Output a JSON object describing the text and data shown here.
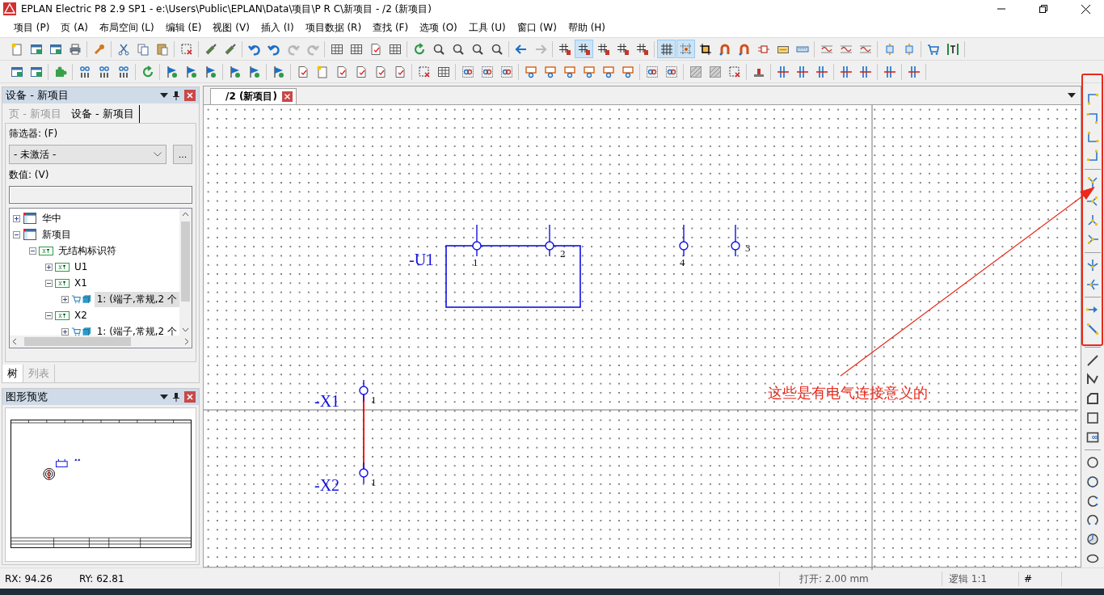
{
  "window": {
    "title": "EPLAN Electric P8 2.9 SP1 - e:\\Users\\Public\\EPLAN\\Data\\项目\\P R C\\新项目 - /2 (新项目)"
  },
  "menu": [
    "项目 (P)",
    "页 (A)",
    "布局空间 (L)",
    "编辑 (E)",
    "视图 (V)",
    "插入 (I)",
    "项目数据 (R)",
    "查找 (F)",
    "选项 (O)",
    "工具 (U)",
    "窗口 (W)",
    "帮助 (H)"
  ],
  "toolbars": [
    [
      [
        {
          "kind": "page",
          "pressed": false
        },
        {
          "kind": "window",
          "pressed": false
        },
        {
          "kind": "window",
          "pressed": false
        },
        {
          "kind": "printer",
          "pressed": false
        }
      ],
      [
        {
          "kind": "wrench",
          "pressed": false
        }
      ],
      [
        {
          "kind": "scissors",
          "pressed": false
        },
        {
          "kind": "copy",
          "pressed": false
        },
        {
          "kind": "paste",
          "pressed": false
        }
      ],
      [
        {
          "kind": "select",
          "pressed": false
        }
      ],
      [
        {
          "kind": "brush",
          "pressed": false
        },
        {
          "kind": "brush",
          "pressed": false
        }
      ],
      [
        {
          "kind": "undo",
          "pressed": false
        },
        {
          "kind": "undo",
          "pressed": false
        },
        {
          "kind": "redo",
          "pressed": false
        },
        {
          "kind": "redo",
          "pressed": false
        }
      ],
      [
        {
          "kind": "table",
          "pressed": false
        },
        {
          "kind": "table",
          "pressed": false
        },
        {
          "kind": "doc",
          "pressed": false
        },
        {
          "kind": "table",
          "pressed": false
        }
      ],
      [
        {
          "kind": "refresh",
          "pressed": false
        },
        {
          "kind": "zoom",
          "pressed": false
        },
        {
          "kind": "zoom",
          "pressed": false
        },
        {
          "kind": "zoom",
          "pressed": false
        },
        {
          "kind": "zoom",
          "pressed": false
        }
      ],
      [
        {
          "kind": "arrow-left",
          "pressed": false
        },
        {
          "kind": "arrow-right",
          "pressed": false
        }
      ],
      [
        {
          "kind": "hash",
          "pressed": false
        },
        {
          "kind": "hash",
          "pressed": true
        },
        {
          "kind": "hash",
          "pressed": false
        },
        {
          "kind": "hash",
          "pressed": false
        },
        {
          "kind": "hash",
          "pressed": false
        }
      ],
      [
        {
          "kind": "grid",
          "pressed": true
        },
        {
          "kind": "snap",
          "pressed": true
        },
        {
          "kind": "crop",
          "pressed": false
        },
        {
          "kind": "magnet",
          "pressed": false
        },
        {
          "kind": "magnet",
          "pressed": false
        },
        {
          "kind": "symbol",
          "pressed": false
        },
        {
          "kind": "counter",
          "pressed": false
        },
        {
          "kind": "ruler",
          "pressed": false
        }
      ],
      [
        {
          "kind": "wave",
          "pressed": false
        },
        {
          "kind": "wave",
          "pressed": false
        },
        {
          "kind": "wave",
          "pressed": false
        }
      ],
      [
        {
          "kind": "chip",
          "pressed": false
        },
        {
          "kind": "chip",
          "pressed": false
        }
      ],
      [
        {
          "kind": "cart",
          "pressed": false
        },
        {
          "kind": "frame",
          "pressed": false
        }
      ]
    ],
    [
      [
        {
          "kind": "window",
          "pressed": false
        },
        {
          "kind": "window",
          "pressed": false
        }
      ],
      [
        {
          "kind": "puzzle",
          "pressed": false
        }
      ],
      [
        {
          "kind": "numbers",
          "pressed": false
        },
        {
          "kind": "numbers",
          "pressed": false
        },
        {
          "kind": "numbers",
          "pressed": false
        }
      ],
      [
        {
          "kind": "refresh",
          "pressed": false
        }
      ],
      [
        {
          "kind": "flag",
          "pressed": false
        },
        {
          "kind": "flag",
          "pressed": false
        },
        {
          "kind": "flag",
          "pressed": false
        }
      ],
      [
        {
          "kind": "flag",
          "pressed": false
        },
        {
          "kind": "flag",
          "pressed": false
        }
      ],
      [
        {
          "kind": "flag",
          "pressed": false
        }
      ],
      [
        {
          "kind": "doc",
          "pressed": false
        },
        {
          "kind": "page",
          "pressed": false
        },
        {
          "kind": "doc",
          "pressed": false
        },
        {
          "kind": "doc",
          "pressed": false
        },
        {
          "kind": "doc",
          "pressed": false
        },
        {
          "kind": "doc",
          "pressed": false
        }
      ],
      [
        {
          "kind": "select",
          "pressed": false
        },
        {
          "kind": "table",
          "pressed": false
        }
      ],
      [
        {
          "kind": "rings",
          "pressed": false
        },
        {
          "kind": "rings",
          "pressed": false
        },
        {
          "kind": "rings",
          "pressed": false
        }
      ],
      [
        {
          "kind": "connector",
          "pressed": false
        },
        {
          "kind": "connector",
          "pressed": false
        },
        {
          "kind": "connector",
          "pressed": false
        },
        {
          "kind": "connector",
          "pressed": false
        },
        {
          "kind": "connector",
          "pressed": false
        },
        {
          "kind": "connector",
          "pressed": false
        }
      ],
      [
        {
          "kind": "rings",
          "pressed": false
        },
        {
          "kind": "rings",
          "pressed": false
        }
      ],
      [
        {
          "kind": "hatch",
          "pressed": false
        },
        {
          "kind": "hatch",
          "pressed": false
        },
        {
          "kind": "select",
          "pressed": false
        }
      ],
      [
        {
          "kind": "stamp",
          "pressed": false
        }
      ],
      [
        {
          "kind": "lines",
          "pressed": false
        },
        {
          "kind": "lines",
          "pressed": false
        },
        {
          "kind": "lines",
          "pressed": false
        }
      ],
      [
        {
          "kind": "lines",
          "pressed": false
        },
        {
          "kind": "lines",
          "pressed": false
        }
      ],
      [
        {
          "kind": "lines",
          "pressed": false
        }
      ],
      [
        {
          "kind": "lines",
          "pressed": false
        }
      ]
    ]
  ],
  "device_panel": {
    "title": "设备 - 新项目",
    "tabs": [
      {
        "label": "页 - 新项目",
        "selected": false
      },
      {
        "label": "设备 - 新项目",
        "selected": true
      }
    ],
    "filter_label": "筛选器: (F)",
    "filter_value": "- 未激活 -",
    "filter_button": "...",
    "value_label": "数值: (V)",
    "tree": [
      {
        "kind": "project",
        "label": "华中",
        "expanded": false,
        "selected": false
      },
      {
        "kind": "project",
        "label": "新项目",
        "expanded": true,
        "selected": false,
        "children": [
          {
            "kind": "structure",
            "label": "无结构标识符",
            "expanded": true,
            "selected": false,
            "children": [
              {
                "kind": "structure",
                "label": "U1",
                "expanded": false,
                "selected": false
              },
              {
                "kind": "structure",
                "label": "X1",
                "expanded": true,
                "selected": false,
                "children": [
                  {
                    "kind": "part",
                    "label": "1: (端子,常规,2 个",
                    "expanded": false,
                    "selected": true
                  }
                ]
              },
              {
                "kind": "structure",
                "label": "X2",
                "expanded": true,
                "selected": false,
                "children": [
                  {
                    "kind": "part",
                    "label": "1: (端子,常规,2 个",
                    "expanded": false,
                    "selected": false
                  }
                ]
              }
            ]
          }
        ]
      }
    ],
    "bottom_tabs": [
      {
        "label": "树",
        "selected": true
      },
      {
        "label": "列表",
        "selected": false
      }
    ]
  },
  "preview_panel": {
    "title": "图形预览"
  },
  "document_tab": {
    "label": "/2 (新项目)"
  },
  "schematic": {
    "u1": {
      "name": "-U1",
      "pins": [
        "1",
        "2"
      ]
    },
    "loose_pins": [
      "4",
      "3"
    ],
    "x1": {
      "name": "-X1",
      "pin": "1"
    },
    "x2": {
      "name": "-X2",
      "pin": "1"
    }
  },
  "annotation": "这些是有电气连接意义的",
  "status_bar": {
    "rx": "RX: 94.26",
    "ry": "RY: 62.81",
    "grid": "打开: 2.00 mm",
    "logic": "逻辑 1:1",
    "mode": "#"
  }
}
